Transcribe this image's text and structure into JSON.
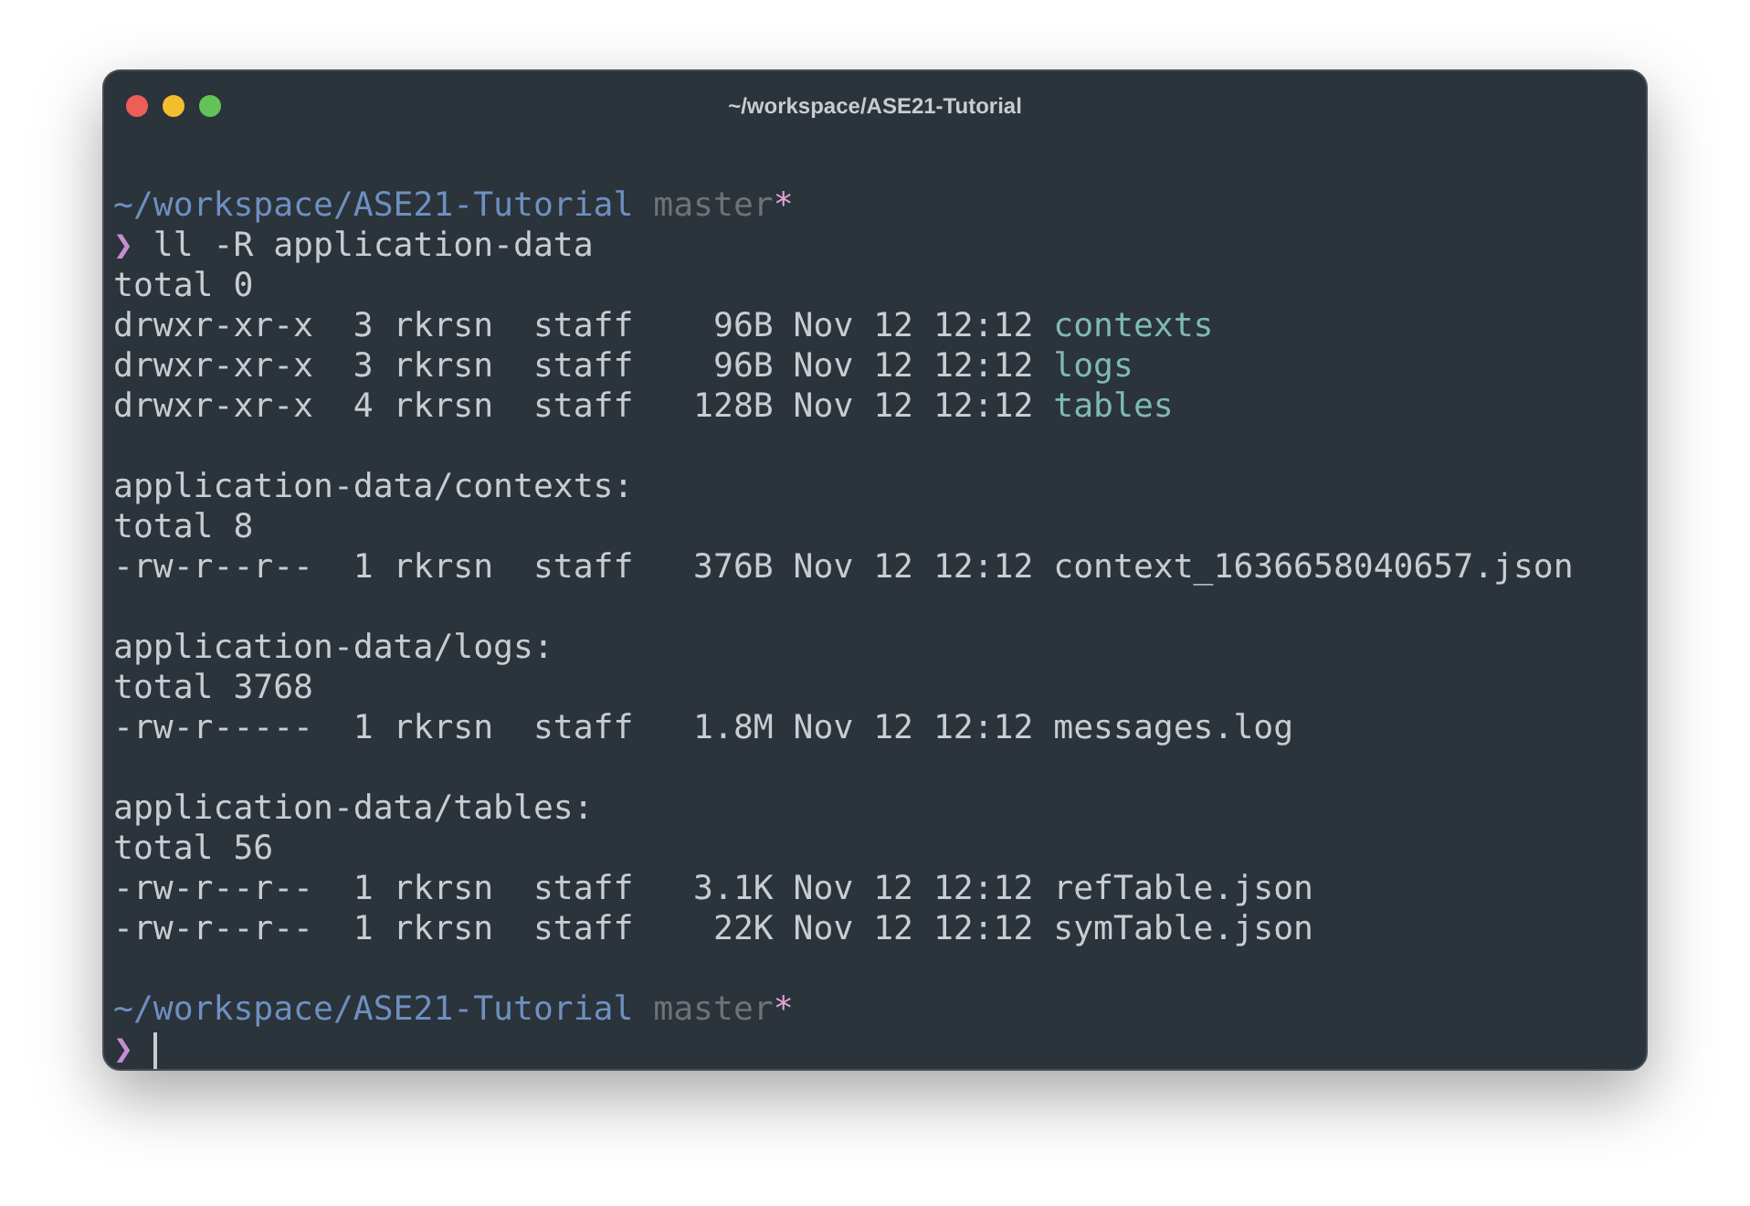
{
  "window": {
    "title": "~/workspace/ASE21-Tutorial"
  },
  "lines": [
    {
      "kind": "prompt",
      "path": "~/workspace/ASE21-Tutorial",
      "branch": "master",
      "dirty_mark": "*"
    },
    {
      "kind": "command",
      "symbol": "❯",
      "text": "ll -R application-data"
    },
    {
      "kind": "output",
      "text": "total 0"
    },
    {
      "kind": "listing",
      "info": "drwxr-xr-x  3 rkrsn  staff    96B Nov 12 12:12 ",
      "name": "contexts",
      "directory": true
    },
    {
      "kind": "listing",
      "info": "drwxr-xr-x  3 rkrsn  staff    96B Nov 12 12:12 ",
      "name": "logs",
      "directory": true
    },
    {
      "kind": "listing",
      "info": "drwxr-xr-x  4 rkrsn  staff   128B Nov 12 12:12 ",
      "name": "tables",
      "directory": true
    },
    {
      "kind": "blank"
    },
    {
      "kind": "output",
      "text": "application-data/contexts:"
    },
    {
      "kind": "output",
      "text": "total 8"
    },
    {
      "kind": "listing",
      "info": "-rw-r--r--  1 rkrsn  staff   376B Nov 12 12:12 ",
      "name": "context_1636658040657.json",
      "directory": false
    },
    {
      "kind": "blank"
    },
    {
      "kind": "output",
      "text": "application-data/logs:"
    },
    {
      "kind": "output",
      "text": "total 3768"
    },
    {
      "kind": "listing",
      "info": "-rw-r-----  1 rkrsn  staff   1.8M Nov 12 12:12 ",
      "name": "messages.log",
      "directory": false
    },
    {
      "kind": "blank"
    },
    {
      "kind": "output",
      "text": "application-data/tables:"
    },
    {
      "kind": "output",
      "text": "total 56"
    },
    {
      "kind": "listing",
      "info": "-rw-r--r--  1 rkrsn  staff   3.1K Nov 12 12:12 ",
      "name": "refTable.json",
      "directory": false
    },
    {
      "kind": "listing",
      "info": "-rw-r--r--  1 rkrsn  staff    22K Nov 12 12:12 ",
      "name": "symTable.json",
      "directory": false
    },
    {
      "kind": "blank"
    },
    {
      "kind": "prompt",
      "path": "~/workspace/ASE21-Tutorial",
      "branch": "master",
      "dirty_mark": "*"
    },
    {
      "kind": "input",
      "symbol": "❯"
    }
  ]
}
